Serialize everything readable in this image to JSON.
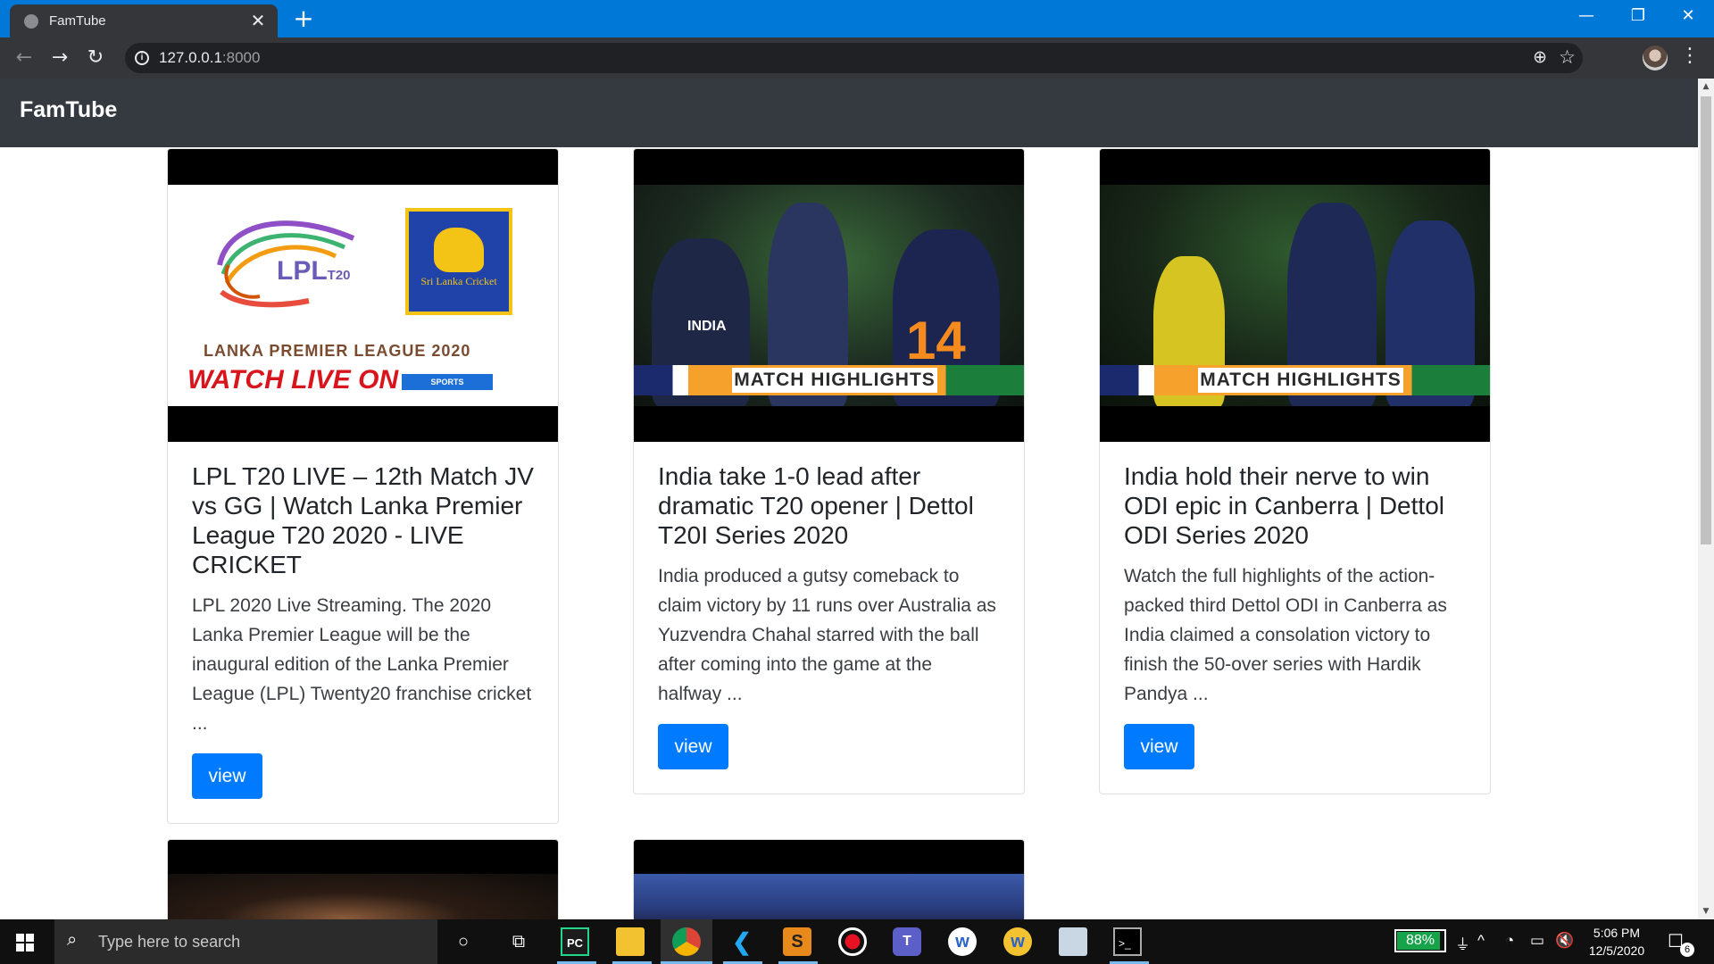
{
  "browser": {
    "tab_title": "FamTube",
    "tab_close": "✕",
    "new_tab": "+",
    "url_host": "127.0.0.1",
    "url_port": ":8000",
    "minimize": "—",
    "restore": "❐",
    "close": "✕",
    "back": "←",
    "forward": "→",
    "reload": "↻",
    "info": "i",
    "zoom": "⊕",
    "star": "☆",
    "menu": "⋮"
  },
  "site": {
    "brand": "FamTube"
  },
  "videos": [
    {
      "title": "LPL T20 LIVE – 12th Match JV vs GG | Watch Lanka Premier League T20 2020 - LIVE CRICKET",
      "description": "LPL 2020 Live Streaming. The 2020 Lanka Premier League will be the inaugural edition of the Lanka Premier League (LPL) Twenty20 franchise cricket ...",
      "button": "view",
      "thumb": {
        "logo": "LPL",
        "logo_suffix": "T20",
        "badge": "Sri Lanka Cricket",
        "caption": "LANKA PREMIER LEAGUE 2020",
        "watch": "WATCH LIVE ON",
        "tag": "SPORTS"
      }
    },
    {
      "title": "India take 1-0 lead after dramatic T20 opener | Dettol T20I Series 2020",
      "description": "India produced a gutsy comeback to claim victory by 11 runs over Australia as Yuzvendra Chahal starred with the ball after coming into the game at the halfway ...",
      "button": "view",
      "thumb": {
        "label": "MATCH HIGHLIGHTS",
        "number": "14",
        "shirt": "INDIA"
      }
    },
    {
      "title": "India hold their nerve to win ODI epic in Canberra | Dettol ODI Series 2020",
      "description": "Watch the full highlights of the action-packed third Dettol ODI in Canberra as India claimed a consolation victory to finish the 50-over series with Hardik Pandya ...",
      "button": "view",
      "thumb": {
        "label": "MATCH HIGHLIGHTS"
      }
    }
  ],
  "scrollbar": {
    "up": "▲",
    "down": "▼"
  },
  "taskbar": {
    "search_placeholder": "Type here to search",
    "search_icon": "⌕",
    "cortana": "○",
    "taskview": "⧉",
    "battery": "88%",
    "time": "5:06 PM",
    "date": "12/5/2020",
    "notifications": "6",
    "tray_up": "^",
    "wifi": "◔",
    "power": "▭",
    "volume": "🔇"
  },
  "colors": {
    "nav_bg": "#343a40",
    "primary": "#007bff",
    "titlebar": "#0078d7"
  }
}
